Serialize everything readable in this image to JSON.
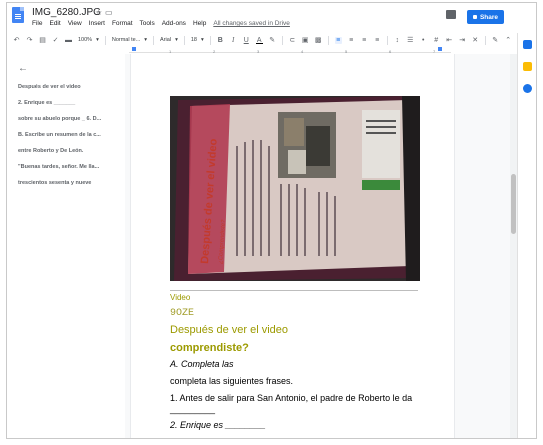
{
  "document": {
    "title": "IMG_6280.JPG",
    "saved_status": "All changes saved in Drive"
  },
  "menu": [
    "File",
    "Edit",
    "View",
    "Insert",
    "Format",
    "Tools",
    "Add-ons",
    "Help"
  ],
  "share_label": "Share",
  "toolbar": {
    "zoom": "100%",
    "style": "Normal te...",
    "font": "Arial",
    "size": "18"
  },
  "ruler_ticks": [
    "1",
    "2",
    "3",
    "4",
    "5",
    "6",
    "7"
  ],
  "outline": [
    "Después de ver el video",
    "2. Enrique es _______",
    "sobre su abuelo porque _ 6. D...",
    "B. Escribe un resumen de la c...",
    "entre Roberto y De León.",
    "\"Buenas tardes, señor. Me lla...",
    "trescientos sesenta y nueve"
  ],
  "body": {
    "line1": "Video",
    "line2": "9OZE",
    "line3": "Después de ver el video",
    "line4": "comprendiste?",
    "line5": "A. Completa las",
    "line6": "completa las siguientes frases.",
    "line7": "1. Antes de salir para San Antonio, el padre de Roberto le da",
    "line8": "_________",
    "line9": "2. Enrique es ________"
  },
  "photo": {
    "heading": "Después de ver el video",
    "subheading": "¿Comprendiste?"
  },
  "colors": {
    "accent_blue": "#1a73e8",
    "olive_heading": "#9c9a00",
    "photo_page": "#d9c9c4",
    "photo_heading": "#c33a2c"
  }
}
